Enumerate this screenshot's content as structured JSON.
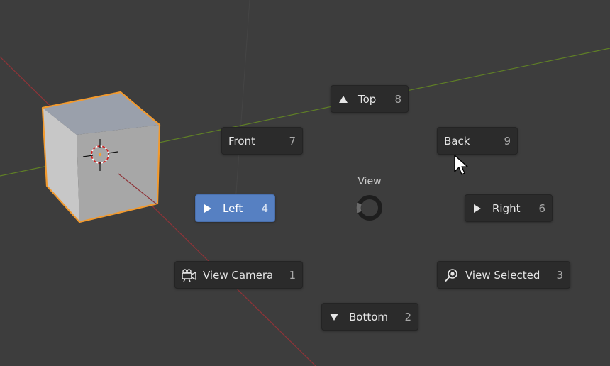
{
  "pie_menu": {
    "title": "View",
    "items": [
      {
        "id": "top",
        "label": "Top",
        "key": "8",
        "icon": "triangle-up-icon"
      },
      {
        "id": "front",
        "label": "Front",
        "key": "7"
      },
      {
        "id": "back",
        "label": "Back",
        "key": "9"
      },
      {
        "id": "left",
        "label": "Left",
        "key": "4",
        "icon": "triangle-right-icon",
        "active": true
      },
      {
        "id": "right",
        "label": "Right",
        "key": "6",
        "icon": "triangle-right-icon"
      },
      {
        "id": "view_camera",
        "label": "View Camera",
        "key": "1",
        "icon": "camera-icon"
      },
      {
        "id": "view_selected",
        "label": "View Selected",
        "key": "3",
        "icon": "zoom-selected-icon"
      },
      {
        "id": "bottom",
        "label": "Bottom",
        "key": "2",
        "icon": "triangle-down-icon"
      }
    ]
  },
  "colors": {
    "viewport_bg": "#3d3d3d",
    "button_bg": "#2b2b2b",
    "button_active": "#5680c2",
    "x_axis": "#8f3338",
    "y_axis": "#5f7f26",
    "selection_outline": "#f29a2e"
  }
}
